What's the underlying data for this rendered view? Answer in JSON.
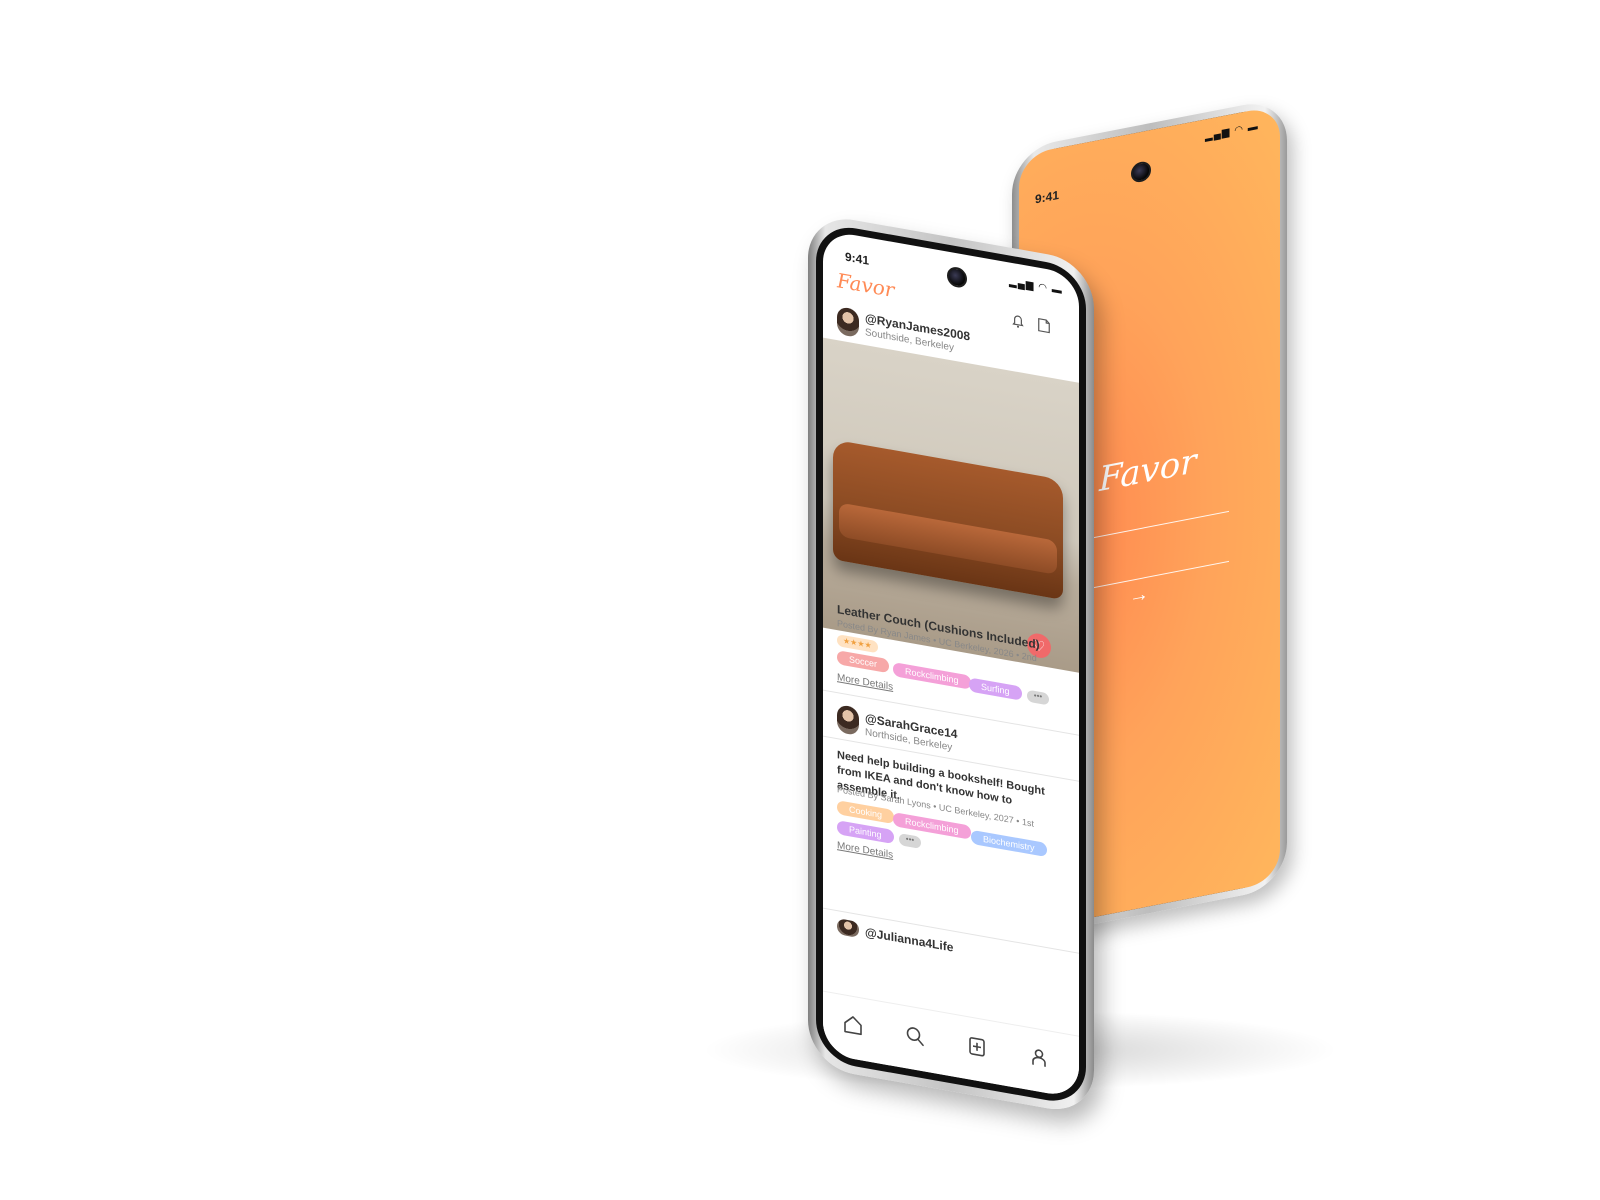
{
  "back_phone": {
    "status_time": "9:41",
    "logo": "Favor",
    "continue_arrow": "→",
    "gradient_colors": [
      "#ff8a50",
      "#ffb65c"
    ]
  },
  "front_phone": {
    "status_time": "9:41",
    "logo": "Favor",
    "header_icons": [
      "bell-icon",
      "book-icon"
    ],
    "posts": [
      {
        "handle": "@RyanJames2008",
        "location": "Southside, Berkeley",
        "title": "Leather Couch (Cushions Included)",
        "posted_by": "Posted By Ryan James",
        "school": "UC Berkeley, 2026",
        "connection": "2nd",
        "rating_stars": 4,
        "rating_label": "★★★★",
        "tags": [
          "Soccer",
          "Rockclimbing",
          "Surfing"
        ],
        "more_tags": "•••",
        "more_details": "More Details"
      },
      {
        "handle": "@SarahGrace14",
        "location": "Northside, Berkeley",
        "body": "Need help building a bookshelf! Bought from IKEA and don't know how to assemble it.",
        "posted_by": "Posted By Sarah Lyons",
        "school": "UC Berkeley, 2027",
        "connection": "1st",
        "tags": [
          "Cooking",
          "Rockclimbing",
          "Biochemistry",
          "Painting"
        ],
        "more_tags": "•••",
        "more_details": "More Details"
      },
      {
        "handle": "@Julianna4Life"
      }
    ],
    "tabbar": [
      "home-icon",
      "search-icon",
      "add-post-icon",
      "profile-icon"
    ],
    "accent_color": "#ff8a55",
    "tag_colors": {
      "Soccer": "#f7a8a8",
      "Rockclimbing": "#f4a0d8",
      "Surfing": "#d6a3f5",
      "Cooking": "#ffd0a0",
      "Biochemistry": "#a9c8ff",
      "Painting": "#d6a3f5"
    }
  }
}
